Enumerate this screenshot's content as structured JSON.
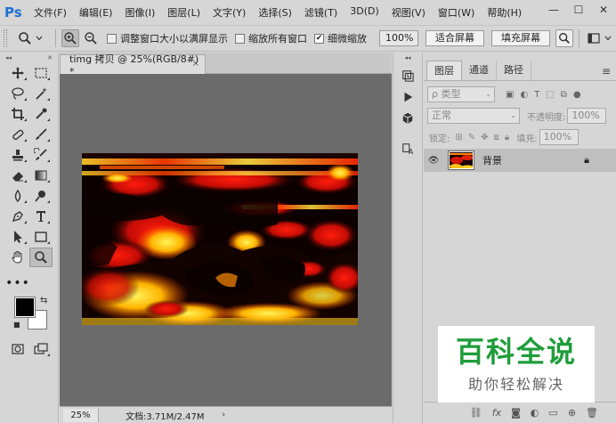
{
  "app": {
    "logo": "Ps",
    "menus": [
      "文件(F)",
      "编辑(E)",
      "图像(I)",
      "图层(L)",
      "文字(Y)",
      "选择(S)",
      "滤镜(T)",
      "3D(D)",
      "视图(V)",
      "窗口(W)",
      "帮助(H)"
    ],
    "window_controls": {
      "minimize": "—",
      "maximize": "☐",
      "close": "✕"
    }
  },
  "options_bar": {
    "resize_windows_label": "调整窗口大小以满屏显示",
    "resize_windows_checked": false,
    "zoom_all_label": "缩放所有窗口",
    "zoom_all_checked": false,
    "scrubby_zoom_label": "细微缩放",
    "scrubby_zoom_checked": true,
    "zoom_percent": "100%",
    "fit_screen_label": "适合屏幕",
    "fill_screen_label": "填充屏幕"
  },
  "document": {
    "tab_title": "timg 拷贝 @ 25%(RGB/8#) *",
    "tab_close": "×",
    "zoom": "25%",
    "info": "文档:3.71M/2.47M",
    "status_arrow": "›"
  },
  "tools": {
    "fg_color": "#000000",
    "bg_color": "#ffffff"
  },
  "layers_panel": {
    "tabs": [
      "图层",
      "通道",
      "路径"
    ],
    "active_tab": 0,
    "menu_icon": "≡",
    "filter_kind": "ρ 类型",
    "blend_mode": "正常",
    "opacity_label": "不透明度:",
    "opacity_value": "100%",
    "lock_label": "锁定:",
    "fill_label": "填充:",
    "fill_value": "100%",
    "layers": [
      {
        "name": "背景",
        "visible": true,
        "locked": true
      }
    ],
    "footer_icons": [
      "link-icon",
      "fx-icon",
      "mask-icon",
      "adjustment-icon",
      "group-icon",
      "new-layer-icon",
      "trash-icon"
    ],
    "footer_fx": "fx"
  },
  "watermark": {
    "main": "百科全说",
    "sub": "助你轻松解决",
    "color": "#1f9d3a"
  }
}
